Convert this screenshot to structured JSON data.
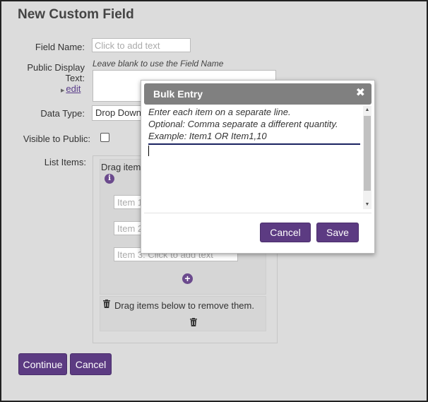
{
  "page": {
    "title": "New Custom Field",
    "field_name": {
      "label": "Field Name:",
      "placeholder": "Click to add text"
    },
    "public_display": {
      "label_line1": "Public Display",
      "label_line2": "Text:",
      "hint": "Leave blank to use the Field Name",
      "edit_link": "edit"
    },
    "data_type": {
      "label": "Data Type:",
      "value": "Drop Down"
    },
    "visible": {
      "label": "Visible to Public:",
      "checked": false
    },
    "list_items": {
      "label": "List Items:",
      "drag_text": "Drag items to reorder them.",
      "items": [
        "Item 1",
        "Item 2",
        "Item 3: Click to add text"
      ],
      "remove_text": "Drag items below to remove them."
    },
    "buttons": {
      "continue": "Continue",
      "cancel": "Cancel"
    }
  },
  "modal": {
    "title": "Bulk Entry",
    "close_glyph": "✖",
    "instructions": [
      "Enter each item on a separate line.",
      "Optional: Comma separate a different quantity.",
      "Example: Item1 OR Item1,10"
    ],
    "buttons": {
      "cancel": "Cancel",
      "save": "Save"
    }
  },
  "colors": {
    "accent": "#5c3b82",
    "header_gray": "#808080",
    "background": "#dcdcdc"
  }
}
